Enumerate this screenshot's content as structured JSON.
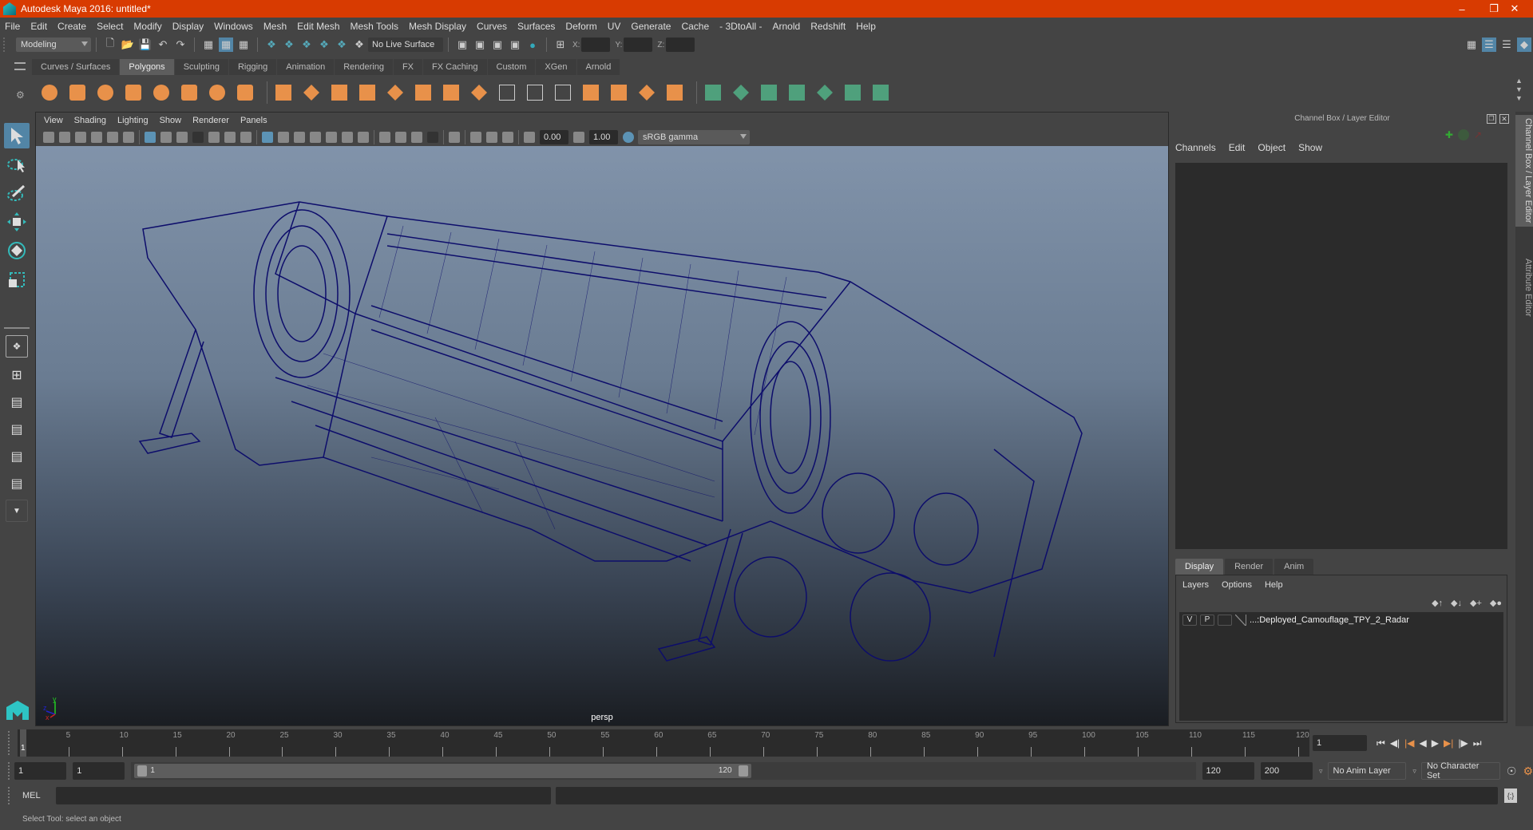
{
  "window": {
    "title": "Autodesk Maya 2016: untitled*"
  },
  "menubar": [
    "File",
    "Edit",
    "Create",
    "Select",
    "Modify",
    "Display",
    "Windows",
    "Mesh",
    "Edit Mesh",
    "Mesh Tools",
    "Mesh Display",
    "Curves",
    "Surfaces",
    "Deform",
    "UV",
    "Generate",
    "Cache",
    "- 3DtoAll -",
    "Arnold",
    "Redshift",
    "Help"
  ],
  "statusline": {
    "mode": "Modeling",
    "live_surface": "No Live Surface",
    "x_label": "X:",
    "y_label": "Y:",
    "z_label": "Z:",
    "x_value": "",
    "y_value": "",
    "z_value": ""
  },
  "shelf": {
    "tabs": [
      "Curves / Surfaces",
      "Polygons",
      "Sculpting",
      "Rigging",
      "Animation",
      "Rendering",
      "FX",
      "FX Caching",
      "Custom",
      "XGen",
      "Arnold"
    ],
    "active_tab": "Polygons",
    "icons": [
      "poly-sphere-icon",
      "poly-cube-icon",
      "poly-cylinder-icon",
      "poly-cone-icon",
      "poly-plane-icon",
      "poly-torus-icon",
      "poly-pyramid-icon",
      "poly-pipe-icon",
      "combine-icon",
      "separate-icon",
      "smooth-icon",
      "extrude-icon",
      "bridge-icon",
      "bevel-icon",
      "multi-cut-icon",
      "append-icon",
      "fill-hole-icon",
      "merge-icon",
      "bridge-edge-icon",
      "edge-loop-icon",
      "insert-edge-icon",
      "crease-icon",
      "target-weld-icon",
      "planar-uv-icon",
      "cylindrical-uv-icon",
      "spherical-uv-icon",
      "automatic-uv-icon",
      "unfold-icon",
      "uv-editor-icon",
      "cut-uv-icon"
    ]
  },
  "viewport": {
    "menu": [
      "View",
      "Shading",
      "Lighting",
      "Show",
      "Renderer",
      "Panels"
    ],
    "exposure": "0.00",
    "gamma": "1.00",
    "color_space": "sRGB gamma",
    "camera_label": "persp",
    "axis": {
      "x": "x",
      "y": "y",
      "z": "z"
    },
    "wireframe_color": "#0d0d6b"
  },
  "channel_box": {
    "title": "Channel Box / Layer Editor",
    "menu": [
      "Channels",
      "Edit",
      "Object",
      "Show"
    ]
  },
  "layer_editor": {
    "tabs": [
      "Display",
      "Render",
      "Anim"
    ],
    "active_tab": "Display",
    "menu": [
      "Layers",
      "Options",
      "Help"
    ],
    "layers": [
      {
        "visible": "V",
        "playback": "P",
        "name": "...:Deployed_Camouflage_TPY_2_Radar"
      }
    ]
  },
  "side_tabs": [
    "Channel Box / Layer Editor",
    "Attribute Editor"
  ],
  "timeline": {
    "ticks": [
      5,
      10,
      15,
      20,
      25,
      30,
      35,
      40,
      45,
      50,
      55,
      60,
      65,
      70,
      75,
      80,
      85,
      90,
      95,
      100,
      105,
      110,
      115,
      120
    ],
    "min": 1,
    "max": 120,
    "current_frame": "1",
    "current_frame_field": "1"
  },
  "range": {
    "start": "1",
    "playback_start": "1",
    "slider_start": "1",
    "slider_end": "120",
    "playback_end": "120",
    "end": "200",
    "anim_layer": "No Anim Layer",
    "character_set": "No Character Set"
  },
  "command_line": {
    "label": "MEL",
    "value": ""
  },
  "help_line": "Select Tool: select an object",
  "colors": {
    "title_bar": "#d83b01",
    "accent": "#5285a6",
    "shelf_orange": "#e8914a",
    "shelf_green": "#4fa07c"
  }
}
